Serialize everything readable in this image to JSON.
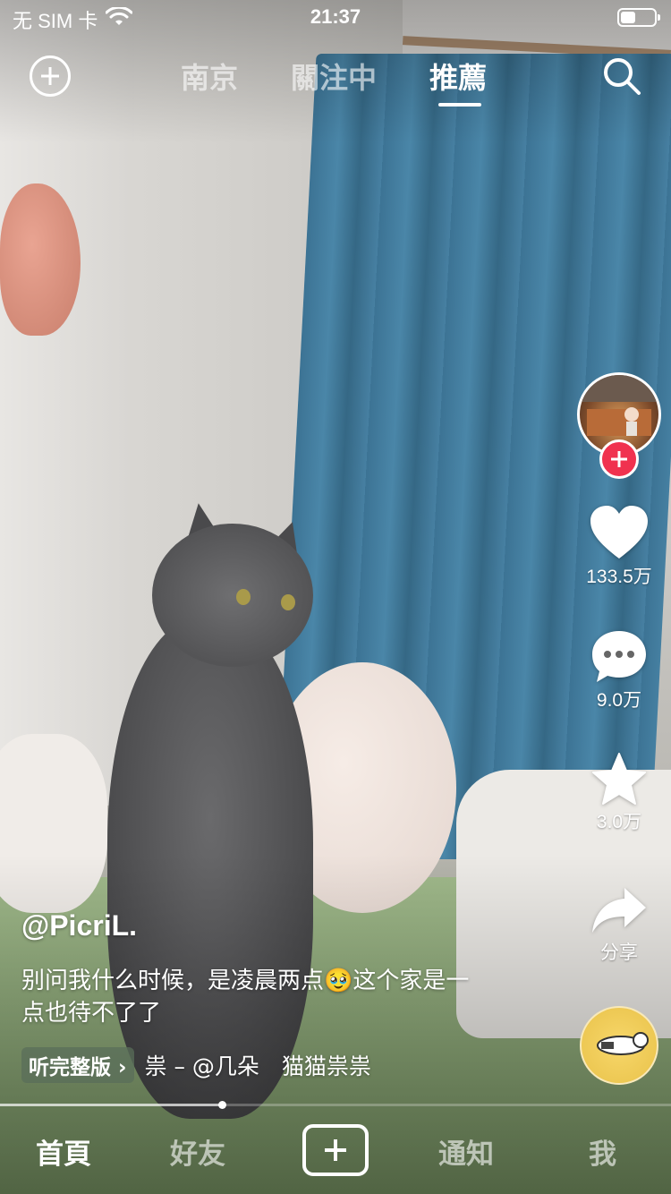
{
  "status_bar": {
    "carrier": "无 SIM 卡",
    "time": "21:37",
    "battery_level": 0.45
  },
  "top_nav": {
    "tabs": [
      {
        "label": "南京",
        "active": false
      },
      {
        "label": "關注中",
        "active": false
      },
      {
        "label": "推薦",
        "active": true
      }
    ],
    "left_icon": "add-circle-icon",
    "right_icon": "search-icon"
  },
  "video": {
    "author": "@PicriL.",
    "description": "别问我什么时候，是凌晨两点🥹这个家是一点也待不了了",
    "listen_full_label": "听完整版",
    "music": "祟 – @几朵　猫猫祟祟",
    "progress": 0.33
  },
  "actions": {
    "like_count": "133.5万",
    "comment_count": "9.0万",
    "favorite_count": "3.0万",
    "share_label": "分享"
  },
  "bottom_nav": {
    "items": [
      {
        "label": "首頁",
        "active": true
      },
      {
        "label": "好友",
        "active": false
      },
      {
        "label": "通知",
        "active": false
      },
      {
        "label": "我",
        "active": false
      }
    ],
    "accent": "#f0324f"
  }
}
